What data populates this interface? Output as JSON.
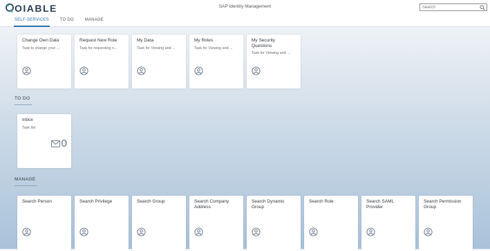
{
  "shell": {
    "logo_text": "OIABLE",
    "app_title": "SAP Identity Management",
    "search_placeholder": "Search"
  },
  "tabs": [
    {
      "label": "SELF-SERVICES",
      "active": true
    },
    {
      "label": "TO DO",
      "active": false
    },
    {
      "label": "MANAGE",
      "active": false
    }
  ],
  "self_services": [
    {
      "title": "Change Own Data",
      "subtitle": "Task to change your ..."
    },
    {
      "title": "Request New Role",
      "subtitle": "Task for requesting n..."
    },
    {
      "title": "My Data",
      "subtitle": "Task for Viewing and ..."
    },
    {
      "title": "My Roles",
      "subtitle": "Task for Viewing and ..."
    },
    {
      "title": "My Security Questions",
      "subtitle": "Task for Viewing and ..."
    }
  ],
  "todo": {
    "section_title": "TO DO",
    "inbox": {
      "title": "Inbox",
      "subtitle": "Task list",
      "count": "0"
    }
  },
  "manage": {
    "section_title": "MANAGE",
    "tiles": [
      {
        "title": "Search Person"
      },
      {
        "title": "Search Privilege"
      },
      {
        "title": "Search Group"
      },
      {
        "title": "Search Company Address"
      },
      {
        "title": "Search Dynamic Group"
      },
      {
        "title": "Search Role"
      },
      {
        "title": "Search SAML Provider"
      },
      {
        "title": "Search Permission Group"
      }
    ]
  },
  "icons": {
    "tile_icon": "person-icon",
    "inbox_icon": "envelope-icon",
    "search_icon": "search-icon"
  },
  "colors": {
    "accent": "#2a6fb8",
    "icon": "#5e6e80"
  }
}
